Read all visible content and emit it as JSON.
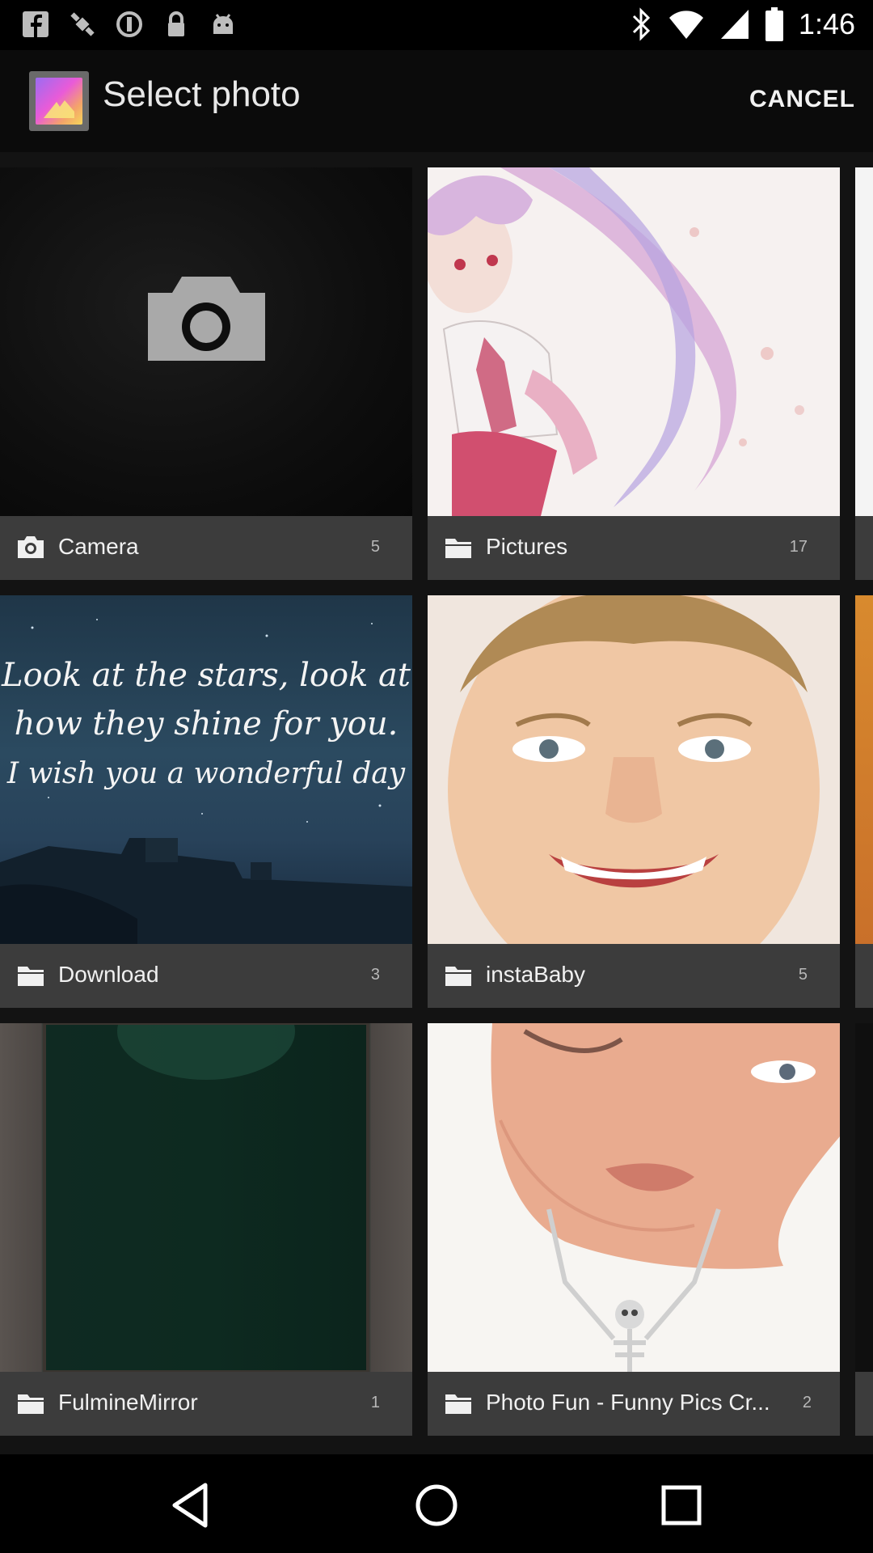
{
  "status_bar": {
    "time": "1:46",
    "icons": [
      "facebook-icon",
      "gps-satellite-icon",
      "sync-icon",
      "lock-icon",
      "android-icon",
      "bluetooth-icon",
      "wifi-icon",
      "signal-icon",
      "battery-icon"
    ]
  },
  "header": {
    "title": "Select photo",
    "cancel_label": "CANCEL"
  },
  "albums": [
    {
      "name": "Camera",
      "count": "5",
      "icon": "camera-icon"
    },
    {
      "name": "Pictures",
      "count": "17",
      "icon": "folder-icon"
    },
    {
      "name": "Download",
      "count": "3",
      "icon": "folder-icon"
    },
    {
      "name": "instaBaby",
      "count": "5",
      "icon": "folder-icon"
    },
    {
      "name": "FulmineMirror",
      "count": "1",
      "icon": "folder-icon"
    },
    {
      "name": "Photo Fun - Funny Pics Cr...",
      "count": "2",
      "icon": "folder-icon"
    }
  ],
  "thumbnails": {
    "download_quote": [
      "Look at the stars, look at",
      "how they shine for you.",
      "I wish you a wonderful day"
    ]
  },
  "nav": {
    "icons": [
      "back-icon",
      "home-icon",
      "recents-icon"
    ]
  },
  "colors": {
    "caption_bg": "#3c3c3c",
    "grid_bg": "#131313",
    "action_bar_bg": "#0b0b0b"
  }
}
